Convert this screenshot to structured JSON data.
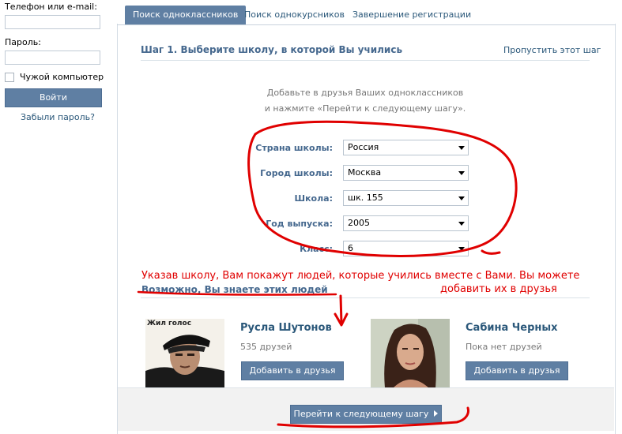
{
  "login": {
    "login_label": "Телефон или e-mail:",
    "password_label": "Пароль:",
    "remember_label": "Чужой компьютер",
    "login_button": "Войти",
    "forgot_link": "Забыли пароль?"
  },
  "tabs": [
    {
      "label": "Поиск одноклассников",
      "active": true
    },
    {
      "label": "Поиск однокурсников",
      "active": false
    },
    {
      "label": "Завершение регистрации",
      "active": false
    }
  ],
  "step": {
    "title": "Шаг 1. Выберите школу, в которой Вы учились",
    "skip_link": "Пропустить этот шаг",
    "intro_line1": "Добавьте в друзья Ваших одноклассников",
    "intro_line2": "и нажмите «Перейти к следующему шагу»."
  },
  "form": [
    {
      "label": "Страна школы:",
      "value": "Россия"
    },
    {
      "label": "Город школы:",
      "value": "Москва"
    },
    {
      "label": "Школа:",
      "value": "шк. 155"
    },
    {
      "label": "Год выпуска:",
      "value": "2005"
    },
    {
      "label": "Класс:",
      "value": "6"
    }
  ],
  "people": {
    "title": "Возможно, Вы знаете этих людей",
    "items": [
      {
        "name": "Русла Шутонов",
        "friends": "535 друзей",
        "add_label": "Добавить в друзья",
        "photo_caption": "Жил голос"
      },
      {
        "name": "Сабина Черных",
        "friends": "Пока нет друзей",
        "add_label": "Добавить в друзья"
      }
    ]
  },
  "footer": {
    "next_button": "Перейти к следующему шагу"
  },
  "annotation": {
    "line1": "Указав школу, Вам покажут людей, которые учились вместе с Вами. Вы можете",
    "line2": "добавить их в друзья",
    "color": "#e00000"
  },
  "colors": {
    "accent": "#5f7fa3",
    "link": "#2b587a",
    "label": "#45688e"
  }
}
